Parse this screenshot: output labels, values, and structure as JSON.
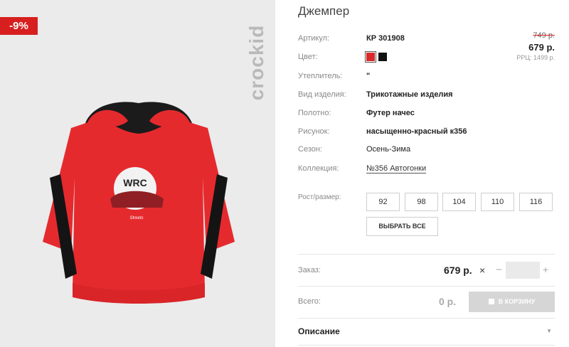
{
  "image": {
    "discount_badge": "-9%",
    "brand_logo": "crockid",
    "print_text": "WRC",
    "print_subtext": "Streets"
  },
  "product": {
    "title": "Джемпер",
    "specs": [
      {
        "label": "Артикул:",
        "value": "КР 301908"
      },
      {
        "label": "Цвет:",
        "value": ""
      },
      {
        "label": "Утеплитель:",
        "value": "\""
      },
      {
        "label": "Вид изделия:",
        "value": "Трикотажные изделия"
      },
      {
        "label": "Полотно:",
        "value": "Футер начес"
      },
      {
        "label": "Рисунок:",
        "value": "насыщенно-красный к356"
      },
      {
        "label": "Сезон:",
        "value": "Осень-Зима"
      },
      {
        "label": "Коллекция:",
        "value": "№356 Автогонки"
      }
    ],
    "colors": [
      "#d82a2a",
      "#111111"
    ]
  },
  "price": {
    "old": "749 р.",
    "new": "679 р.",
    "rrc": "РРЦ: 1499 р."
  },
  "sizes": {
    "label": "Рост/размер:",
    "options": [
      "92",
      "98",
      "104",
      "110",
      "116"
    ],
    "select_all": "ВЫБРАТЬ ВСЕ"
  },
  "order": {
    "label": "Заказ:",
    "price": "679 р.",
    "qty": ""
  },
  "total": {
    "label": "Всего:",
    "value": "0 р.",
    "cart_button": "В КОРЗИНУ"
  },
  "description": {
    "title": "Описание"
  }
}
